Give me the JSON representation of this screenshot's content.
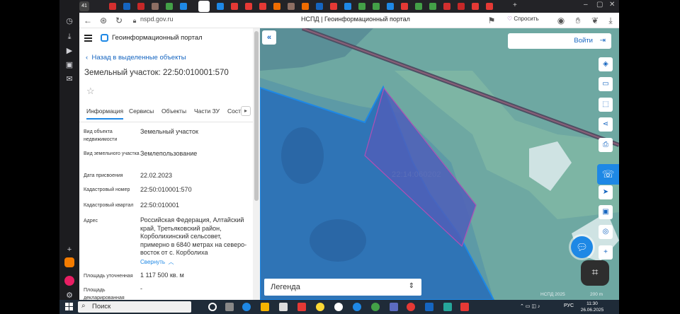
{
  "browser": {
    "url": "nspd.gov.ru",
    "page_title": "НСПД | Геоинформационный портал",
    "ask_label": "Спросить",
    "counter_badge": "41"
  },
  "portal": {
    "name": "Геоинформационный портал",
    "back_label": "Назад в выделенные объекты",
    "object_title": "Земельный участок: 22:50:010001:570",
    "tabs": [
      "Информация",
      "Сервисы",
      "Объекты",
      "Части ЗУ",
      "Сості"
    ],
    "active_tab": "Информация",
    "fields": [
      {
        "label": "Вид объекта недвижимости",
        "value": "Земельный участок"
      },
      {
        "label": "Вид земельного участка",
        "value": "Землепользование"
      },
      {
        "label": "Дата присвоения",
        "value": "22.02.2023"
      },
      {
        "label": "Кадастровый номер",
        "value": "22:50:010001:570"
      },
      {
        "label": "Кадастровый квартал",
        "value": "22:50:010001"
      },
      {
        "label": "Адрес",
        "value": "Российская Федерация, Алтайский край, Третьяковский район, Корболихинский сельсовет, примерно в 6840 метрах на северо-восток от с. Корболиха"
      },
      {
        "label": "Площадь уточненная",
        "value": "1 117 500 кв. м"
      },
      {
        "label": "Площадь декларированная",
        "value": "-"
      }
    ],
    "collapse_label": "Свернуть"
  },
  "map": {
    "login_label": "Войти",
    "legend_label": "Легенда",
    "parcel_label": "22:14:060202",
    "attribution": "НСПД 2025",
    "scale": "200 m",
    "colors": {
      "water": "#5d9aa6",
      "selected_region": "#2f74b6",
      "selected_parcel": "#4f5fb8",
      "accent": "#1e88e5"
    }
  },
  "taskbar": {
    "search_label": "Поиск",
    "lang": "РУС",
    "time": "11:30",
    "date": "26.06.2025"
  }
}
